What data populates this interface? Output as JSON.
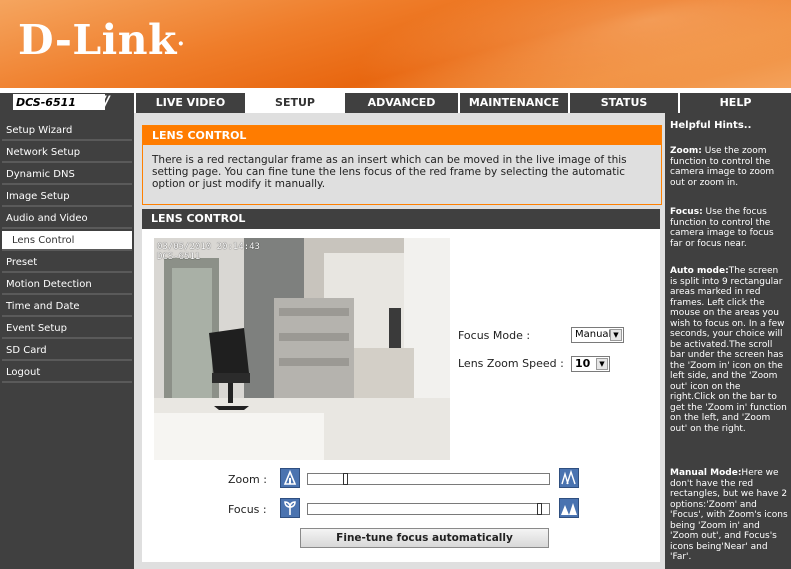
{
  "brand": {
    "logo_text": "D-Link",
    "model": "DCS-6511"
  },
  "tabs": [
    {
      "label": "LIVE VIDEO",
      "active": false
    },
    {
      "label": "SETUP",
      "active": true
    },
    {
      "label": "ADVANCED",
      "active": false
    },
    {
      "label": "MAINTENANCE",
      "active": false
    },
    {
      "label": "STATUS",
      "active": false
    },
    {
      "label": "HELP",
      "active": false
    }
  ],
  "sidebar": {
    "items": [
      {
        "label": "Setup Wizard"
      },
      {
        "label": "Network Setup"
      },
      {
        "label": "Dynamic DNS"
      },
      {
        "label": "Image Setup"
      },
      {
        "label": "Audio and Video"
      },
      {
        "label": "Lens Control",
        "active": true
      },
      {
        "label": "Preset"
      },
      {
        "label": "Motion Detection"
      },
      {
        "label": "Time and Date"
      },
      {
        "label": "Event Setup"
      },
      {
        "label": "SD Card"
      },
      {
        "label": "Logout"
      }
    ]
  },
  "intro": {
    "title": "LENS CONTROL",
    "text": "There is a red rectangular frame as an insert which can be moved in the live image of this setting page. You can fine tune the lens focus of the red frame by selecting the automatic option or just modify it manually."
  },
  "lens": {
    "title": "LENS CONTROL",
    "timestamp": "03/05/2010 20:14:43",
    "camera_label": "DCS-6511",
    "focus_mode_label": "Focus Mode :",
    "focus_mode_value": "Manual",
    "zoom_speed_label": "Lens Zoom Speed :",
    "zoom_speed_value": "10",
    "zoom_label": "Zoom :",
    "focus_label": "Focus :",
    "zoom_position": 0.15,
    "focus_position": 0.97,
    "fine_tune_label": "Fine-tune focus automatically"
  },
  "hints": {
    "title": "Helpful Hints..",
    "zoom_title": "Zoom:",
    "zoom_text": " Use the zoom function to control the camera image to zoom out or zoom in.",
    "focus_title": "Focus:",
    "focus_text": " Use the focus function to control the camera image to focus far or focus near.",
    "auto_title": "Auto mode:",
    "auto_text": "The screen is split into 9 rectangular areas marked in red frames. Left click the mouse on the areas you wish to focus on. In a few seconds, your choice will be activated.The scroll bar under the screen has the 'Zoom in' icon on the left side, and the 'Zoom out' icon on the right.Click on the bar to get the 'Zoom in' function on the left, and 'Zoom out' on the right.",
    "manual_title": "Manual Mode:",
    "manual_text": "Here we don't have the red rectangles, but we have 2 options:'Zoom' and 'Focus', with Zoom's icons being 'Zoom in' and 'Zoom out', and Focus's icons being'Near' and 'Far'."
  },
  "colors": {
    "accent": "#ff7c00",
    "nav": "#404040"
  }
}
